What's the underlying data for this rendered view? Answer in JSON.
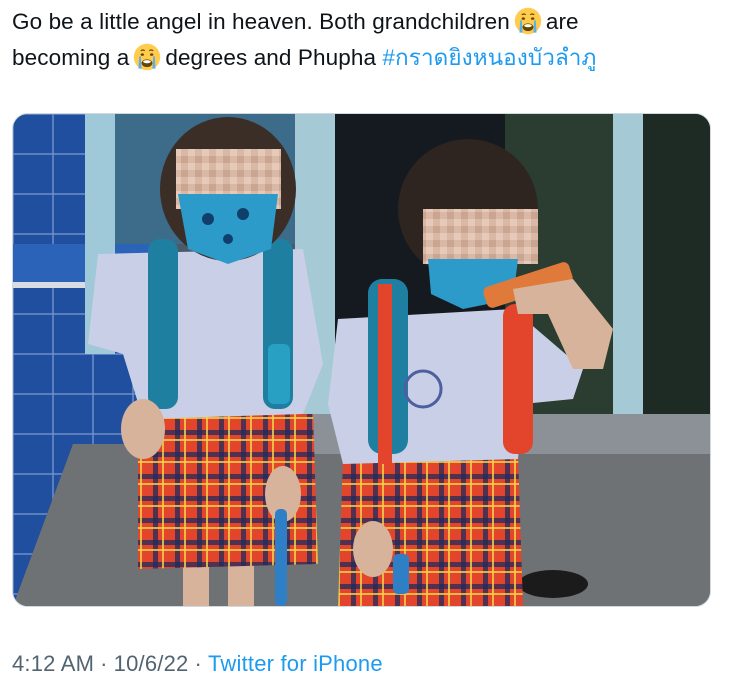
{
  "tweet": {
    "line1_text": "Go be a little angel in heaven. Both grandchildren",
    "line1_end": "are",
    "line2_start": "becoming a",
    "line2_middle": "degrees and Phupha",
    "hashtag": "#กราดยิงหนองบัวลำภู",
    "emoji_name": "crying-face-emoji"
  },
  "media": {
    "alt": "Photo of two young children in school uniforms with plaid shorts and backpacks, faces blurred"
  },
  "meta": {
    "time": "4:12 AM",
    "date": "10/6/22",
    "separator": "·",
    "source": "Twitter for iPhone"
  },
  "colors": {
    "link": "#1d9bf0",
    "text": "#0f1419",
    "muted": "#536471",
    "border": "#cfd9de"
  }
}
